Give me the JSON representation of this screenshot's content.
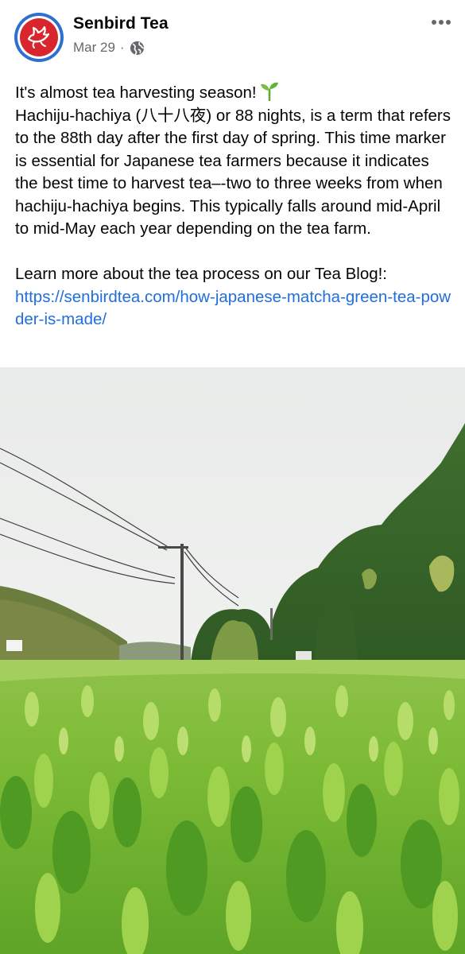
{
  "post": {
    "author": "Senbird Tea",
    "date": "Mar 29",
    "separator": "·",
    "privacy_icon": "globe-icon",
    "menu_icon": "more-options-icon",
    "avatar_icon": "bird-logo",
    "headline": "It's almost tea harvesting season!",
    "headline_emoji": "seedling-icon",
    "body": "Hachiju-hachiya (八十八夜) or 88 nights, is a term that refers to the 88th day after the first day of spring. This time marker is essential for Japanese tea farmers because it indicates the best time to harvest tea–-two to three weeks from when hachiju-hachiya begins. This typically falls around mid-April to mid-May each year depending on the tea farm.",
    "cta": "Learn more about the tea process on our Tea Blog!:",
    "link": "https://senbirdtea.com/how-japanese-matcha-green-tea-powder-is-made/"
  },
  "colors": {
    "brand_red": "#d9262e",
    "ring_blue": "#2f6fd0",
    "link_blue": "#216fdb",
    "meta_gray": "#65676b"
  }
}
